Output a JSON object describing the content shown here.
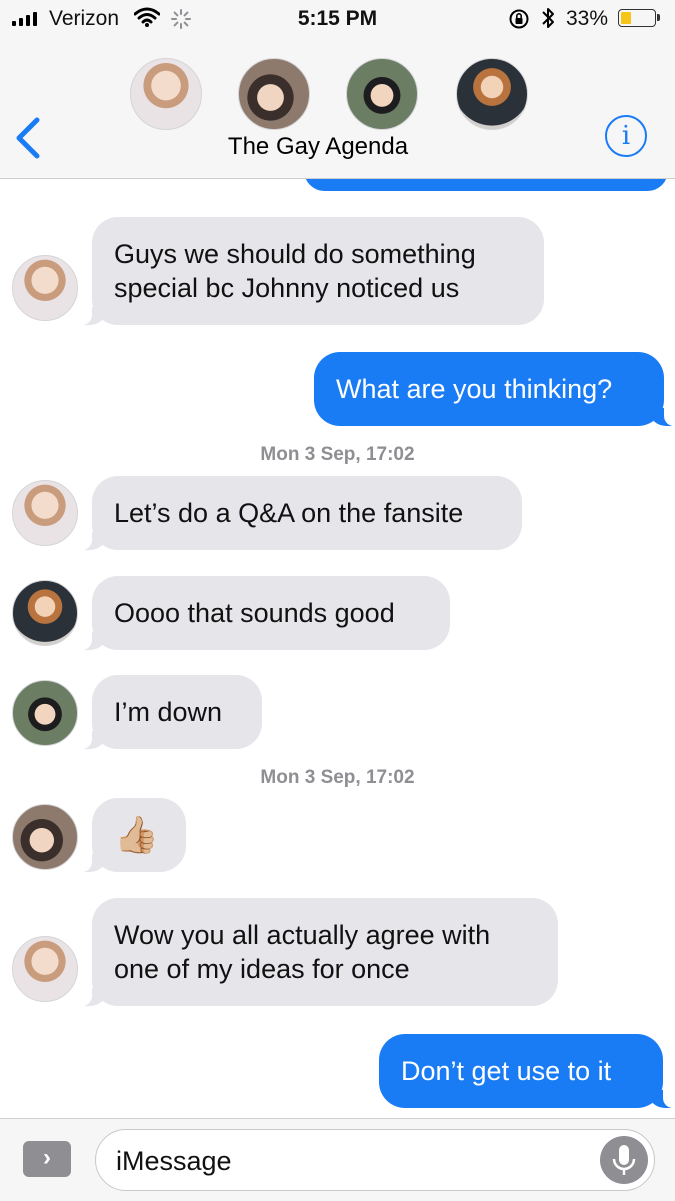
{
  "status_bar": {
    "carrier": "Verizon",
    "time": "5:15 PM",
    "battery_percent": "33%",
    "battery_level": 0.33,
    "battery_color": "#f5c518"
  },
  "nav": {
    "group_name": "The Gay Agenda",
    "back_icon": "chevron-left-icon",
    "info_icon": "info-icon",
    "info_glyph": "i",
    "accent_color": "#1a7cf5"
  },
  "messages": [
    {
      "direction": "in",
      "text": [
        "Guys we should do something",
        "special bc Johnny noticed us"
      ]
    },
    {
      "direction": "out",
      "text": [
        "What are you thinking?"
      ]
    },
    {
      "timestamp": "Mon 3 Sep, 17:02"
    },
    {
      "direction": "in",
      "text": [
        "Let’s do a Q&A on the fansite"
      ]
    },
    {
      "direction": "in",
      "text": [
        "Oooo that sounds good"
      ]
    },
    {
      "direction": "in",
      "text": [
        "I’m down"
      ]
    },
    {
      "timestamp": "Mon 3 Sep, 17:02"
    },
    {
      "direction": "in",
      "text": [
        "👍🏼"
      ]
    },
    {
      "direction": "in",
      "text": [
        "Wow you all actually agree with",
        "one of my ideas for once"
      ]
    },
    {
      "direction": "out",
      "text": [
        "Don’t get use to it"
      ]
    }
  ],
  "compose": {
    "placeholder": "iMessage",
    "apps_glyph": "›",
    "apps_icon": "chevron-right-icon",
    "mic_icon": "microphone-icon"
  },
  "colors": {
    "outgoing_bubble": "#1a7cf5",
    "incoming_bubble": "#e5e5ea",
    "timestamp_text": "#8e8e93"
  }
}
